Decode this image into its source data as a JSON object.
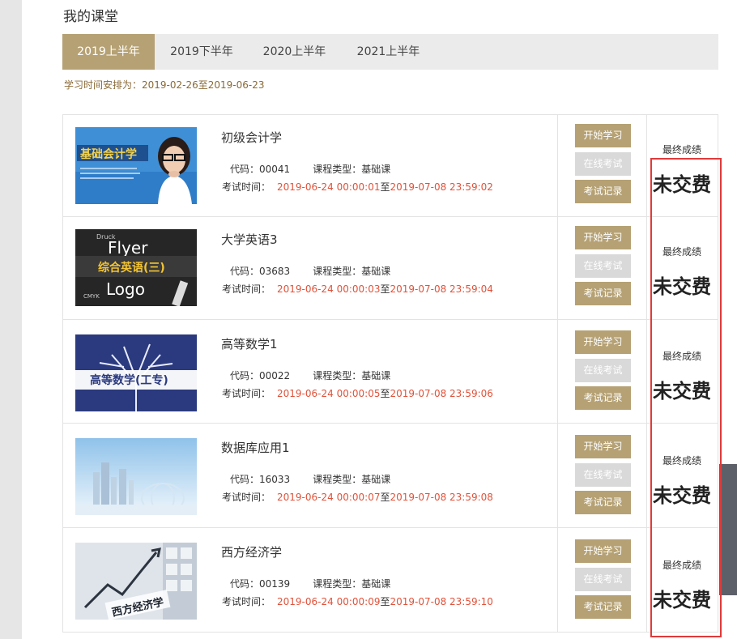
{
  "page": {
    "title": "我的课堂"
  },
  "tabs": [
    {
      "label": "2019上半年",
      "active": true
    },
    {
      "label": "2019下半年",
      "active": false
    },
    {
      "label": "2020上半年",
      "active": false
    },
    {
      "label": "2021上半年",
      "active": false
    }
  ],
  "schedule": {
    "label": "学习时间安排为：",
    "value": "2019-02-26至2019-06-23"
  },
  "labels": {
    "code": "代码：",
    "course_type": "课程类型：",
    "exam_time": "考试时间：",
    "to": "至",
    "start_study": "开始学习",
    "online_exam": "在线考试",
    "exam_record": "考试记录",
    "final_score": "最终成绩"
  },
  "courses": [
    {
      "name": "初级会计学",
      "code": "00041",
      "type": "基础课",
      "exam_start": "2019-06-24 00:00:01",
      "exam_end": "2019-07-08 23:59:02",
      "score": "未交费",
      "thumb_text": "基础会计学",
      "thumb_icon": "woman-with-glasses-thumbnail"
    },
    {
      "name": "大学英语3",
      "code": "03683",
      "type": "基础课",
      "exam_start": "2019-06-24 00:00:03",
      "exam_end": "2019-07-08 23:59:04",
      "score": "未交费",
      "thumb_text": "综合英语(三)",
      "thumb_words": [
        "Druck",
        "Flyer",
        "Logo",
        "CMYK"
      ]
    },
    {
      "name": "高等数学1",
      "code": "00022",
      "type": "基础课",
      "exam_start": "2019-06-24 00:00:05",
      "exam_end": "2019-07-08 23:59:06",
      "score": "未交费",
      "thumb_text": "高等数学(工专)"
    },
    {
      "name": "数据库应用1",
      "code": "16033",
      "type": "基础课",
      "exam_start": "2019-06-24 00:00:07",
      "exam_end": "2019-07-08 23:59:08",
      "score": "未交费",
      "thumb_icon": "city-skyline-thumbnail"
    },
    {
      "name": "西方经济学",
      "code": "00139",
      "type": "基础课",
      "exam_start": "2019-06-24 00:00:09",
      "exam_end": "2019-07-08 23:59:10",
      "score": "未交费",
      "thumb_text": "西方经济学"
    }
  ],
  "colors": {
    "accent": "#b5a174",
    "disabled": "#d9d9d9",
    "time_red": "#e0523a",
    "highlight": "#e03a3a"
  }
}
